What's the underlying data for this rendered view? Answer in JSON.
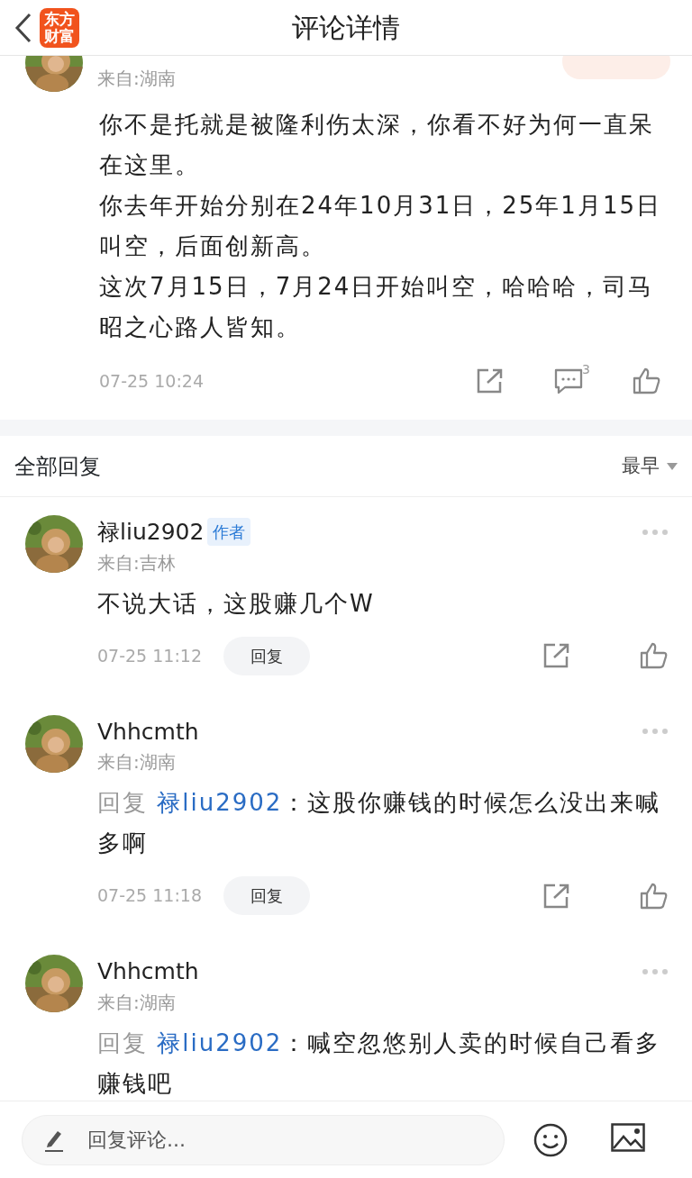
{
  "header": {
    "title": "评论详情",
    "logo_lines": [
      "东方",
      "财富"
    ]
  },
  "main_comment": {
    "location": "来自:湖南",
    "paragraphs": [
      "你不是托就是被隆利伤太深，你看不好为何一直呆在这里。",
      "你去年开始分别在24年10月31日，25年1月15日叫空，后面创新高。",
      "这次7月15日，7月24日开始叫空，哈哈哈，司马昭之心路人皆知。"
    ],
    "time": "07-25 10:24",
    "comment_count": "3"
  },
  "replies_header": {
    "title": "全部回复",
    "sort": "最早"
  },
  "replies": [
    {
      "name": "禄liu2902",
      "badge": "作者",
      "location": "来自:吉林",
      "text": "不说大话，这股赚几个W",
      "time": "07-25 11:12",
      "reply_button": "回复"
    },
    {
      "name": "Vhhcmth",
      "location": "来自:湖南",
      "reply_prefix": "回复",
      "reply_to": "禄liu2902",
      "text": "：这股你赚钱的时候怎么没出来喊多啊",
      "time": "07-25 11:18",
      "reply_button": "回复"
    },
    {
      "name": "Vhhcmth",
      "location": "来自:湖南",
      "reply_prefix": "回复",
      "reply_to": "禄liu2902",
      "text": "：喊空忽悠别人卖的时候自己看多赚钱吧"
    }
  ],
  "composer": {
    "placeholder": "回复评论..."
  }
}
